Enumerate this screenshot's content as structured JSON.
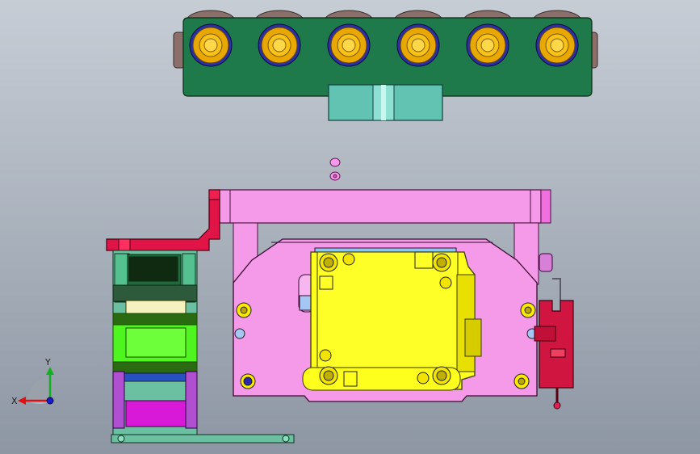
{
  "viewport": {
    "background_top": "#c7cdd5",
    "background_bottom": "#8d96a3"
  },
  "model": {
    "name": "cad-assembly-top-view",
    "parts": [
      {
        "name": "roller-rail-plate",
        "color": "#1e7a4a"
      },
      {
        "name": "roller",
        "count": 6,
        "color": "#f0b400",
        "ring_color": "#2b2fa3"
      },
      {
        "name": "cyan-mount-block",
        "color": "#62c3b2"
      },
      {
        "name": "pink-crossbeam",
        "color": "#f49ae8"
      },
      {
        "name": "pink-base-plate",
        "color": "#f49ae8"
      },
      {
        "name": "yellow-cylinder-body",
        "color": "#ffff1e"
      },
      {
        "name": "red-bent-bracket",
        "color": "#e01446"
      },
      {
        "name": "green-clamp-stack",
        "color": "#4ef51e"
      },
      {
        "name": "magenta-block",
        "color": "#d81ad8"
      },
      {
        "name": "red-sensor-switch",
        "color": "#d01640"
      }
    ]
  },
  "triad": {
    "x_label": "X",
    "y_label": "Y",
    "x_color": "#e01010",
    "y_color": "#10b020",
    "z_color": "#1a1ad0"
  }
}
